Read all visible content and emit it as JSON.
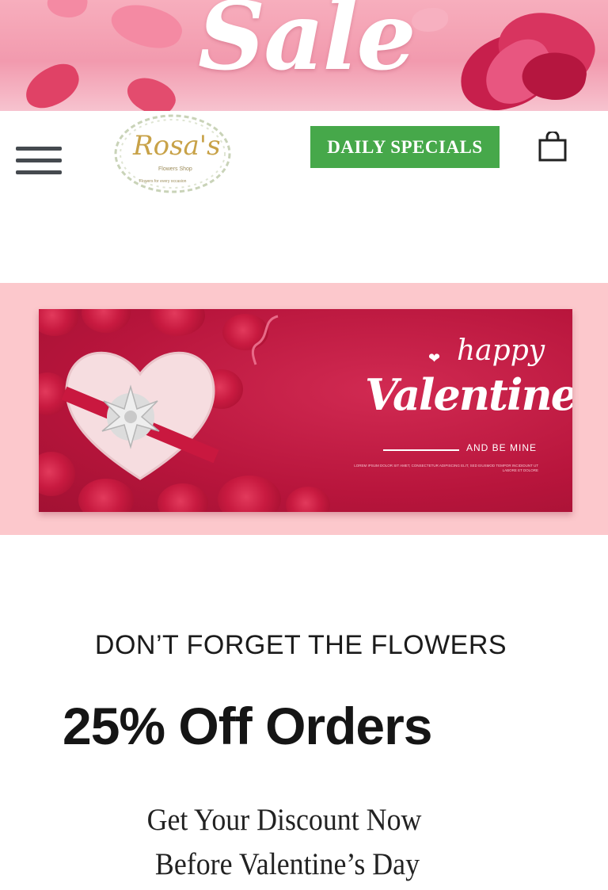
{
  "banner": {
    "sale_text": "Sale"
  },
  "header": {
    "logo_text": "Rosa's",
    "logo_subtitle": "Flowers Shop",
    "logo_tagline": "Flowers for every occasion",
    "daily_specials_label": "DAILY SPECIALS"
  },
  "valentine_banner": {
    "happy": "happy",
    "valentines": "Valentine's",
    "be_mine": "AND BE MINE",
    "fine_print": "LOREM IPSUM DOLOR SIT AMET, CONSECTETUR ADIPISCING ELIT, SED EIUSMOD TEMPOR INCIDIDUNT UT LABORE ET DOLORE"
  },
  "promo": {
    "heading": "DON’T FORGET THE FLOWERS",
    "offer": "25% Off Orders",
    "line1": "Get Your  Discount Now",
    "line2": "Before Valentine’s Day"
  },
  "colors": {
    "daily_specials_bg": "#46a84a",
    "banner_pink": "#fcc8cc",
    "valentine_red": "#b8153c"
  },
  "icons": [
    "menu-icon",
    "cart-icon",
    "bow-icon",
    "heart-icon"
  ]
}
